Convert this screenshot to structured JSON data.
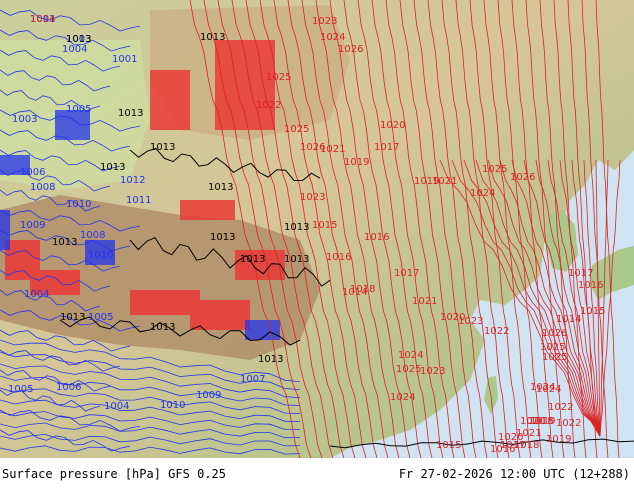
{
  "footer": {
    "product": "Surface pressure [hPa] GFS 0.25",
    "valid_time": "Fr 27-02-2026 12:00 UTC (12+288)"
  },
  "colors": {
    "low_isobar": "#2233ee",
    "high_isobar": "#dd2222",
    "mid_isobar": "#000000",
    "sea": "#cfe3f2",
    "land_low": "#a8c98a",
    "land_mid": "#d8c89a",
    "land_high": "#b08e6a"
  },
  "isobar_labels": [
    {
      "text": "1001",
      "tone": "blue"
    },
    {
      "text": "1003",
      "tone": "blue"
    },
    {
      "text": "1004",
      "tone": "blue"
    },
    {
      "text": "1001",
      "tone": "blue"
    },
    {
      "text": "1005",
      "tone": "blue"
    },
    {
      "text": "1003",
      "tone": "blue"
    },
    {
      "text": "1006",
      "tone": "blue"
    },
    {
      "text": "1008",
      "tone": "blue"
    },
    {
      "text": "1010",
      "tone": "blue"
    },
    {
      "text": "1011",
      "tone": "blue"
    },
    {
      "text": "1012",
      "tone": "blue"
    },
    {
      "text": "1009",
      "tone": "blue"
    },
    {
      "text": "1008",
      "tone": "blue"
    },
    {
      "text": "1010",
      "tone": "blue"
    },
    {
      "text": "1004",
      "tone": "blue"
    },
    {
      "text": "1005",
      "tone": "blue"
    },
    {
      "text": "1004",
      "tone": "blue"
    },
    {
      "text": "1006",
      "tone": "blue"
    },
    {
      "text": "1005",
      "tone": "blue"
    },
    {
      "text": "1010",
      "tone": "blue"
    },
    {
      "text": "1009",
      "tone": "blue"
    },
    {
      "text": "1007",
      "tone": "blue"
    },
    {
      "text": "1013",
      "tone": "black"
    },
    {
      "text": "1013",
      "tone": "black"
    },
    {
      "text": "1013",
      "tone": "black"
    },
    {
      "text": "1013",
      "tone": "black"
    },
    {
      "text": "1013",
      "tone": "black"
    },
    {
      "text": "1013",
      "tone": "black"
    },
    {
      "text": "1013",
      "tone": "black"
    },
    {
      "text": "1013",
      "tone": "black"
    },
    {
      "text": "1013",
      "tone": "black"
    },
    {
      "text": "1013",
      "tone": "black"
    },
    {
      "text": "1013",
      "tone": "black"
    },
    {
      "text": "1013",
      "tone": "black"
    },
    {
      "text": "1013",
      "tone": "black"
    },
    {
      "text": "1023",
      "tone": "red"
    },
    {
      "text": "1024",
      "tone": "red"
    },
    {
      "text": "1026",
      "tone": "red"
    },
    {
      "text": "1025",
      "tone": "red"
    },
    {
      "text": "1022",
      "tone": "red"
    },
    {
      "text": "1025",
      "tone": "red"
    },
    {
      "text": "1026",
      "tone": "red"
    },
    {
      "text": "1021",
      "tone": "red"
    },
    {
      "text": "1019",
      "tone": "red"
    },
    {
      "text": "1017",
      "tone": "red"
    },
    {
      "text": "1020",
      "tone": "red"
    },
    {
      "text": "1019",
      "tone": "red"
    },
    {
      "text": "1021",
      "tone": "red"
    },
    {
      "text": "1024",
      "tone": "red"
    },
    {
      "text": "1025",
      "tone": "red"
    },
    {
      "text": "1026",
      "tone": "red"
    },
    {
      "text": "1023",
      "tone": "red"
    },
    {
      "text": "1015",
      "tone": "red"
    },
    {
      "text": "1016",
      "tone": "red"
    },
    {
      "text": "1014",
      "tone": "red"
    },
    {
      "text": "1018",
      "tone": "red"
    },
    {
      "text": "1016",
      "tone": "red"
    },
    {
      "text": "1017",
      "tone": "red"
    },
    {
      "text": "1021",
      "tone": "red"
    },
    {
      "text": "1020",
      "tone": "red"
    },
    {
      "text": "1023",
      "tone": "red"
    },
    {
      "text": "1022",
      "tone": "red"
    },
    {
      "text": "1024",
      "tone": "red"
    },
    {
      "text": "1025",
      "tone": "red"
    },
    {
      "text": "1024",
      "tone": "red"
    },
    {
      "text": "1023",
      "tone": "red"
    },
    {
      "text": "1025",
      "tone": "red"
    },
    {
      "text": "1024",
      "tone": "red"
    },
    {
      "text": "1022",
      "tone": "red"
    },
    {
      "text": "1020",
      "tone": "red"
    },
    {
      "text": "1018",
      "tone": "red"
    },
    {
      "text": "1019",
      "tone": "red"
    },
    {
      "text": "1017",
      "tone": "red"
    },
    {
      "text": "1016",
      "tone": "red"
    },
    {
      "text": "1015",
      "tone": "red"
    },
    {
      "text": "1014",
      "tone": "red"
    },
    {
      "text": "1026",
      "tone": "red"
    },
    {
      "text": "1025",
      "tone": "red"
    },
    {
      "text": "1024",
      "tone": "red"
    },
    {
      "text": "1022",
      "tone": "red"
    },
    {
      "text": "1021",
      "tone": "red"
    },
    {
      "text": "1020",
      "tone": "red"
    },
    {
      "text": "1019",
      "tone": "red"
    },
    {
      "text": "1018",
      "tone": "red"
    },
    {
      "text": "1017",
      "tone": "red"
    },
    {
      "text": "1016",
      "tone": "red"
    },
    {
      "text": "1015",
      "tone": "red"
    },
    {
      "text": "1014",
      "tone": "red"
    },
    {
      "text": "1013",
      "tone": "black"
    }
  ]
}
